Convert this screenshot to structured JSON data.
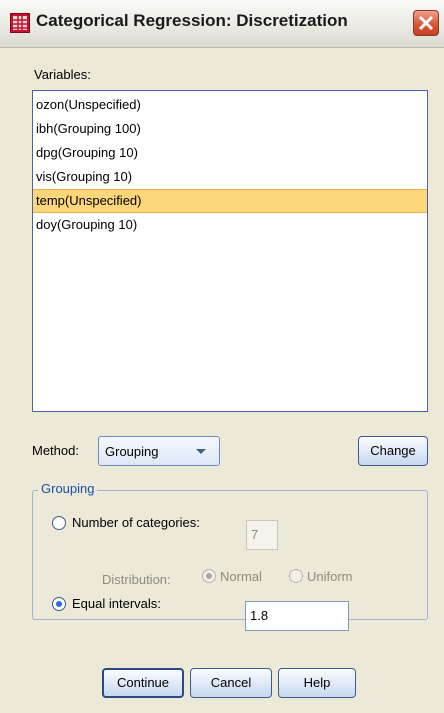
{
  "window": {
    "title": "Categorical Regression: Discretization"
  },
  "variables": {
    "label": "Variables:",
    "items": [
      {
        "label": "ozon(Unspecified)",
        "selected": false
      },
      {
        "label": "ibh(Grouping 100)",
        "selected": false
      },
      {
        "label": "dpg(Grouping 10)",
        "selected": false
      },
      {
        "label": "vis(Grouping 10)",
        "selected": false
      },
      {
        "label": "temp(Unspecified)",
        "selected": true
      },
      {
        "label": "doy(Grouping 10)",
        "selected": false
      }
    ]
  },
  "method": {
    "label": "Method:",
    "value": "Grouping",
    "change_label": "Change"
  },
  "grouping": {
    "title": "Grouping",
    "number_of_categories": {
      "label": "Number of categories:",
      "value": "7",
      "checked": false
    },
    "distribution": {
      "label": "Distribution:",
      "normal": "Normal",
      "uniform": "Uniform",
      "selected": "Normal"
    },
    "equal_intervals": {
      "label": "Equal intervals:",
      "value": "1.8",
      "checked": true
    }
  },
  "buttons": {
    "continue": "Continue",
    "cancel": "Cancel",
    "help": "Help"
  },
  "colors": {
    "selection": "#fcd678",
    "accent": "#2b6be0",
    "close": "#d9573a"
  }
}
